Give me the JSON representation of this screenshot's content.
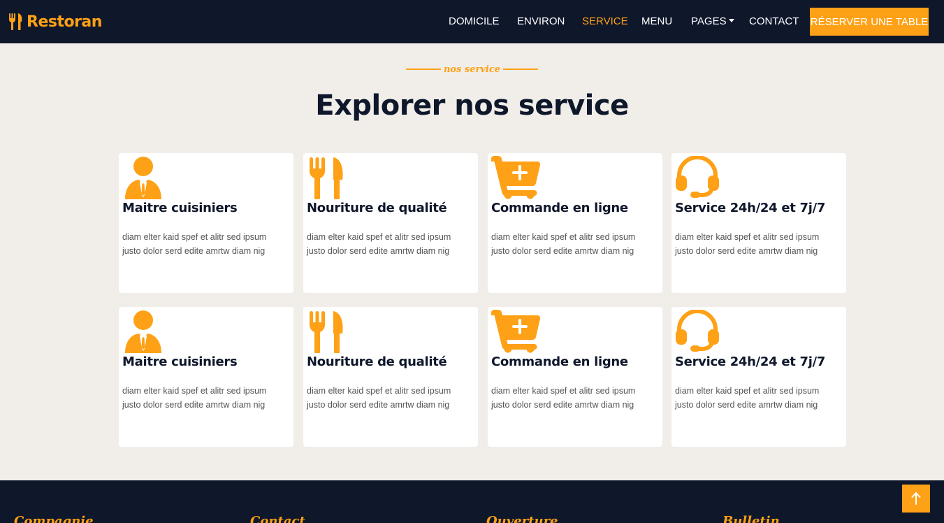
{
  "brand": {
    "name": "Restoran",
    "icon": "utensils-icon",
    "color": "#fea116"
  },
  "nav": {
    "items": [
      {
        "label": "DOMICILE",
        "active": false
      },
      {
        "label": "ENVIRON",
        "active": false
      },
      {
        "label": "SERVICE",
        "active": true
      },
      {
        "label": "MENU",
        "active": false
      },
      {
        "label": "PAGES",
        "active": false,
        "dropdown": true
      },
      {
        "label": "CONTACT",
        "active": false
      }
    ],
    "cta_label": "RÉSERVER UNE TABLE"
  },
  "section": {
    "eyebrow": "nos service",
    "title": "Explorer nos service"
  },
  "services": [
    {
      "icon": "chef-icon",
      "title": "Maitre cuisiniers",
      "text": "diam elter kaid spef et alitr sed ipsum justo dolor serd edite amrtw diam nig"
    },
    {
      "icon": "utensils-icon",
      "title": "Nouriture de qualité",
      "text": "diam elter kaid spef et alitr sed ipsum justo dolor serd edite amrtw diam nig"
    },
    {
      "icon": "cart-plus-icon",
      "title": "Commande en ligne",
      "text": "diam elter kaid spef et alitr sed ipsum justo dolor serd edite amrtw diam nig"
    },
    {
      "icon": "headset-icon",
      "title": "Service 24h/24 et 7j/7",
      "text": "diam elter kaid spef et alitr sed ipsum justo dolor serd edite amrtw diam nig"
    },
    {
      "icon": "chef-icon",
      "title": "Maitre cuisiniers",
      "text": "diam elter kaid spef et alitr sed ipsum justo dolor serd edite amrtw diam nig"
    },
    {
      "icon": "utensils-icon",
      "title": "Nouriture de qualité",
      "text": "diam elter kaid spef et alitr sed ipsum justo dolor serd edite amrtw diam nig"
    },
    {
      "icon": "cart-plus-icon",
      "title": "Commande en ligne",
      "text": "diam elter kaid spef et alitr sed ipsum justo dolor serd edite amrtw diam nig"
    },
    {
      "icon": "headset-icon",
      "title": "Service 24h/24 et 7j/7",
      "text": "diam elter kaid spef et alitr sed ipsum justo dolor serd edite amrtw diam nig"
    }
  ],
  "footer": {
    "headings": [
      "Compagnie",
      "Contact",
      "Ouverture",
      "Bulletin"
    ]
  },
  "back_to_top_icon": "arrow-up-icon"
}
